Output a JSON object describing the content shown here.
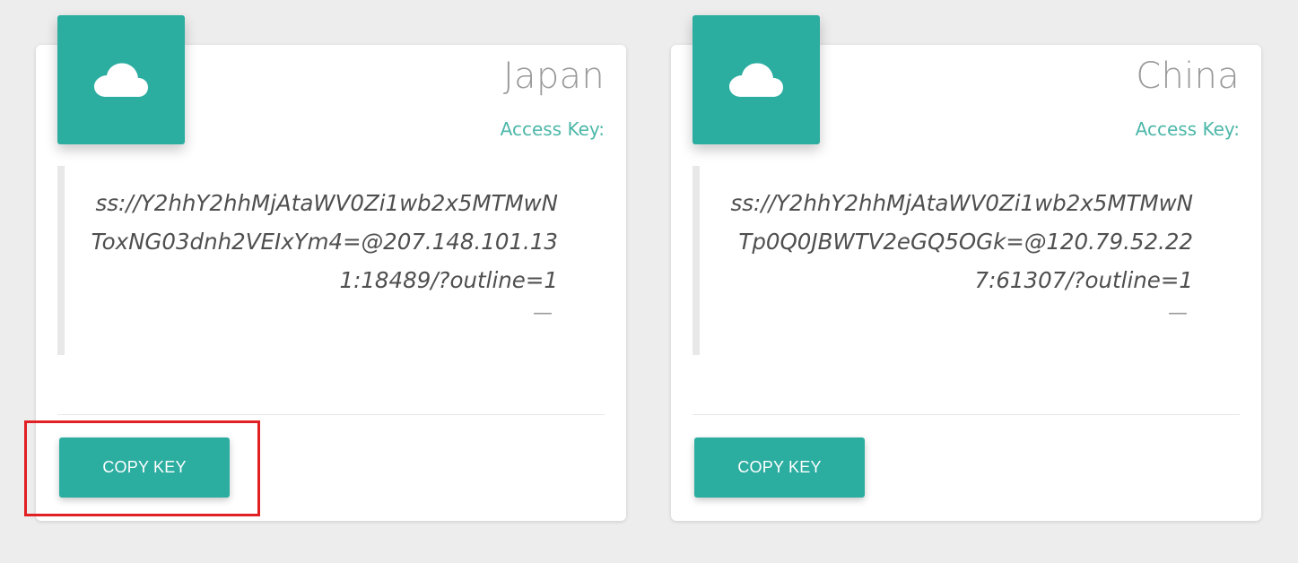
{
  "colors": {
    "accent": "#2bada0",
    "label": "#4cb7a8",
    "highlight": "#e02022"
  },
  "cards": [
    {
      "country": "Japan",
      "access_label": "Access Key:",
      "key": "ss://Y2hhY2hhMjAtaWV0Zi1wb2x5MTMwNToxNG03dnh2VEIxYm4=@207.148.101.131:18489/?outline=1",
      "dash": "—",
      "button_label": "COPY KEY",
      "icon": "cloud-icon"
    },
    {
      "country": "China",
      "access_label": "Access Key:",
      "key": "ss://Y2hhY2hhMjAtaWV0Zi1wb2x5MTMwNTp0Q0JBWTV2eGQ5OGk=@120.79.52.227:61307/?outline=1",
      "dash": "—",
      "button_label": "COPY KEY",
      "icon": "cloud-icon"
    }
  ]
}
